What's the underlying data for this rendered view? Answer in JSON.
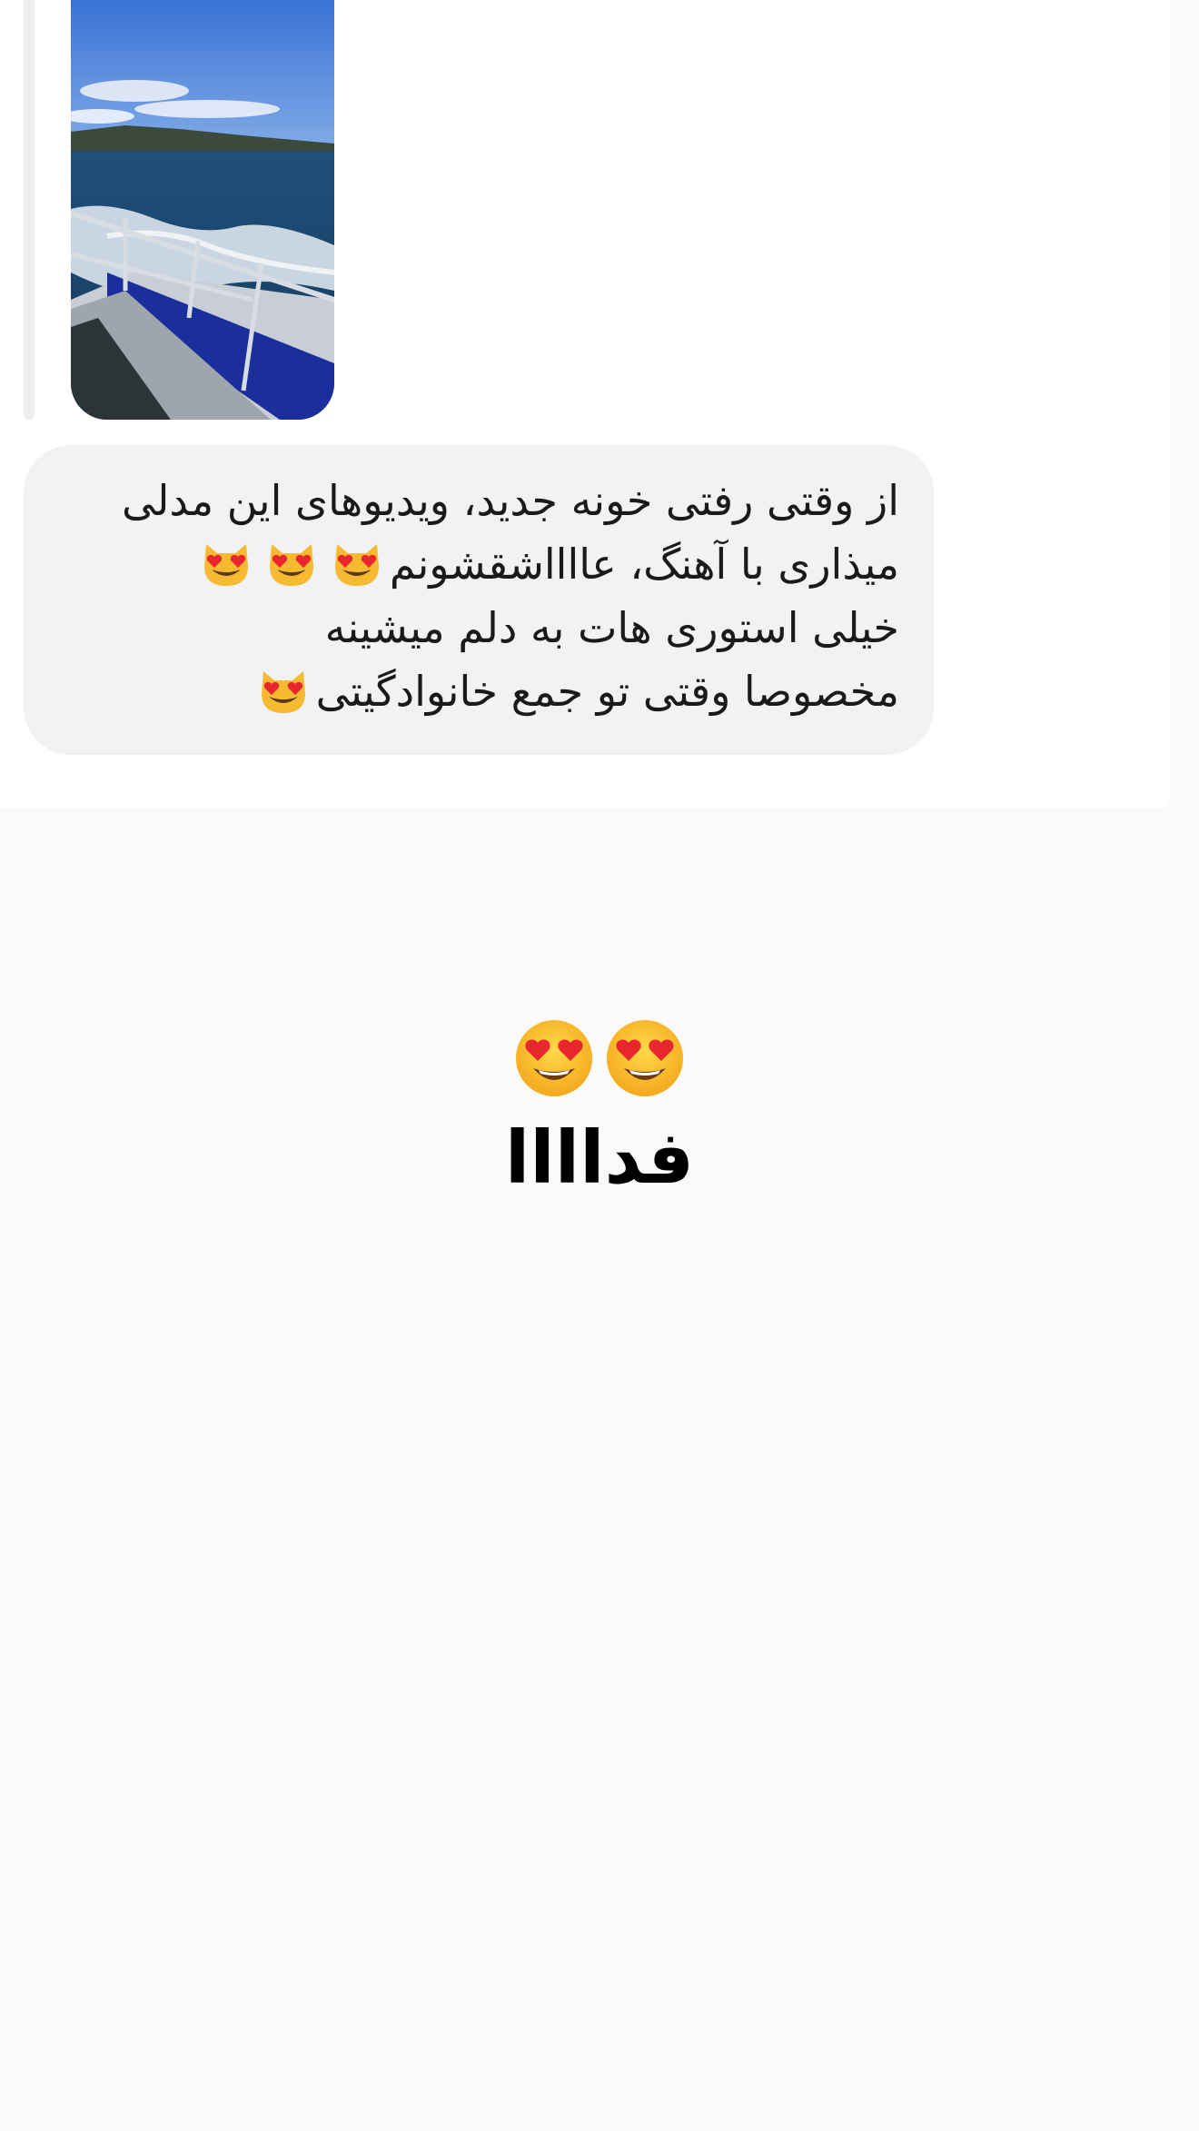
{
  "story_reply": {
    "thumbnail_icon": "boat-sea-photo",
    "colors": {
      "reply_bar": "#efefef",
      "bubble_bg": "#f1f2f4"
    }
  },
  "message": {
    "lines": [
      "از وقتی رفتی خونه جدید، ویدیوهای این مدلی",
      "میذاری با آهنگ، عااااشقشونم",
      "خیلی استوری هات به دلم میشینه",
      "مخصوصا وقتی تو جمع خانوادگیتی"
    ],
    "line_emojis": [
      "",
      "heart-eyes-cat-icon x3",
      "",
      "heart-eyes-cat-icon"
    ]
  },
  "main_message": {
    "emojis": "heart-eyes-face-icon x2",
    "text": "فداااا"
  }
}
